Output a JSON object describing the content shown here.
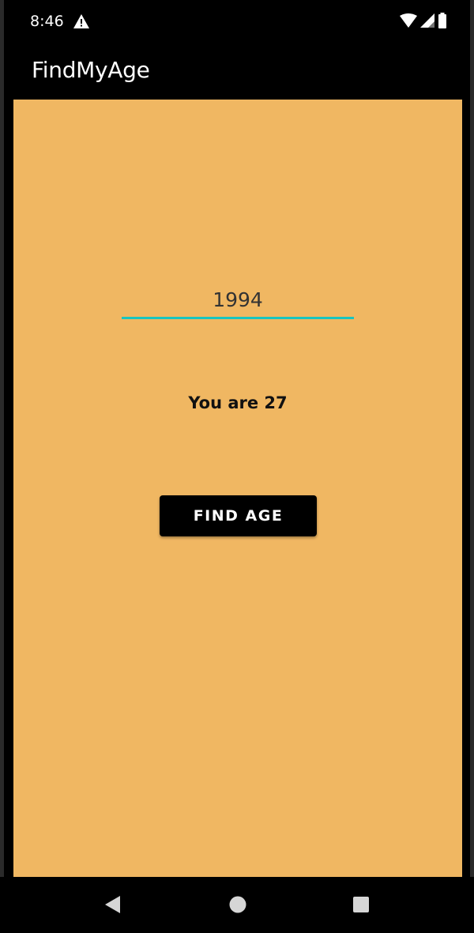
{
  "status_bar": {
    "time": "8:46",
    "icons": [
      "warning-icon",
      "wifi-icon",
      "signal-icon",
      "battery-icon"
    ]
  },
  "app_bar": {
    "title": "FindMyAge"
  },
  "form": {
    "year_value": "1994",
    "result_text": "You are 27",
    "button_label": "FIND AGE"
  },
  "nav_bar": {
    "icons": [
      "back-icon",
      "home-icon",
      "recents-icon"
    ]
  },
  "colors": {
    "background": "#f0b762",
    "app_bar": "#000000",
    "accent": "#18c5c0",
    "button": "#000000",
    "button_text": "#ffffff"
  }
}
